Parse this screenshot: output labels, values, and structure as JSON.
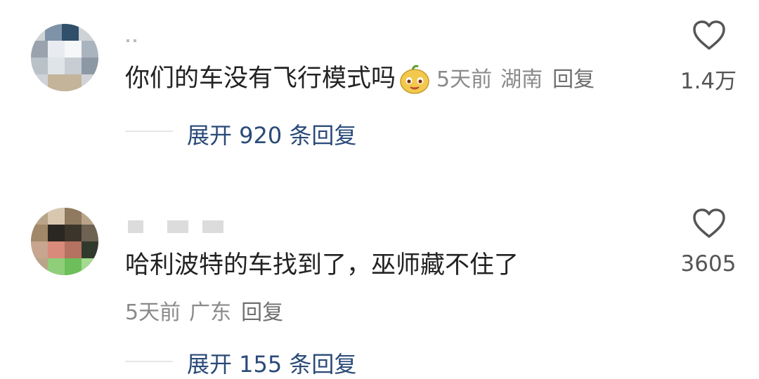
{
  "comments": [
    {
      "text": "你们的车没有飞行模式吗",
      "emoji": "smiling-bean-face-emoji",
      "time": "5天前",
      "location": "湖南",
      "reply": "回复",
      "likes": "1.4万",
      "expand": "展开 920 条回复"
    },
    {
      "text": "哈利波特的车找到了，巫师藏不住了",
      "time": "5天前",
      "location": "广东",
      "reply": "回复",
      "likes": "3605",
      "expand": "展开 155 条回复"
    }
  ],
  "colors": {
    "link": "#2a4a78",
    "meta": "#8a8a8a",
    "text": "#222222"
  }
}
